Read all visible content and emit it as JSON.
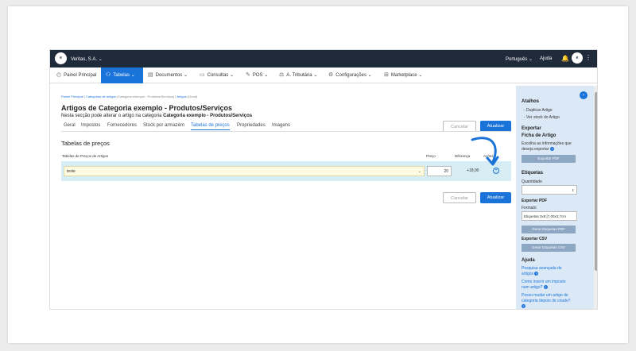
{
  "topbar": {
    "logo": "e",
    "company": "Veritas, S.A.",
    "language": "Português",
    "help": "Ajuda",
    "avatar": "e"
  },
  "menu": [
    {
      "label": "Painel Principal",
      "icon": "dashboard-icon",
      "active": false
    },
    {
      "label": "Tabelas",
      "icon": "users-icon",
      "active": true
    },
    {
      "label": "Documentos",
      "icon": "document-icon",
      "active": false
    },
    {
      "label": "Consultas",
      "icon": "consult-icon",
      "active": false
    },
    {
      "label": "POS",
      "icon": "pos-icon",
      "active": false
    },
    {
      "label": "A. Tributária",
      "icon": "tax-icon",
      "active": false
    },
    {
      "label": "Configurações",
      "icon": "settings-icon",
      "active": false
    },
    {
      "label": "Marketplace",
      "icon": "marketplace-icon",
      "active": false
    }
  ],
  "breadcrumb": {
    "home": "Painel Principal",
    "parent": "Categorias de artigos",
    "parent_detail": "(Categoria exemplo - Produtos/Serviços)",
    "current": "Artigos",
    "current_detail": "(Geral)"
  },
  "page": {
    "title": "Artigos de Categoria exemplo - Produtos/Serviços",
    "subtitle_prefix": "Nesta secção pode alterar o artigo",
    "subtitle_mid": "na categoria",
    "subtitle_category": "Categoria exemplo - Produtos/Serviços"
  },
  "buttons": {
    "cancel": "Cancelar",
    "update": "Atualizar"
  },
  "tabs": [
    "Geral",
    "Impostos",
    "Fornecedores",
    "Stock por armazém",
    "Tabelas de preços",
    "Propriedades",
    "Imagens"
  ],
  "price_tables": {
    "section_title": "Tabelas de preços",
    "columns": {
      "table": "Tabelas de Preços de Artigos",
      "price": "Preço",
      "difference": "Diferença",
      "actions": "Ações"
    },
    "rows": [
      {
        "table": "teste",
        "price": "20",
        "difference": "+18,00"
      }
    ]
  },
  "sidebar": {
    "shortcuts_title": "Atalhos",
    "shortcuts": [
      "- Duplicar Artigo",
      "- Ver stock do Artigo"
    ],
    "export_title": "Exportar",
    "sheet_title": "Ficha de Artigo",
    "sheet_help_1": "Escolha as informações que",
    "sheet_help_2": "deseja exportar",
    "export_pdf_button": "Exportar PDF",
    "labels_title": "Etiquetas",
    "quantity_label": "Quantidade",
    "quantity_value": "1",
    "export_pdf_title": "Exportar PDF",
    "format_label": "Formato",
    "format_value": "Etiquetas 3x8 [7,00x3,7cm",
    "generate_pdf_button": "Gerar Etiquetas PDF",
    "export_csv_title": "Exportar CSV",
    "generate_csv_button": "Gerar Etiquetas CSV",
    "help_title": "Ajuda",
    "help_links": [
      [
        "Pesquisa avançada de",
        "artigos"
      ],
      [
        "Como inserir um imposto",
        "num artigo?"
      ],
      [
        "Posso mudar um artigo de",
        "categoria depois de criado?"
      ]
    ]
  }
}
